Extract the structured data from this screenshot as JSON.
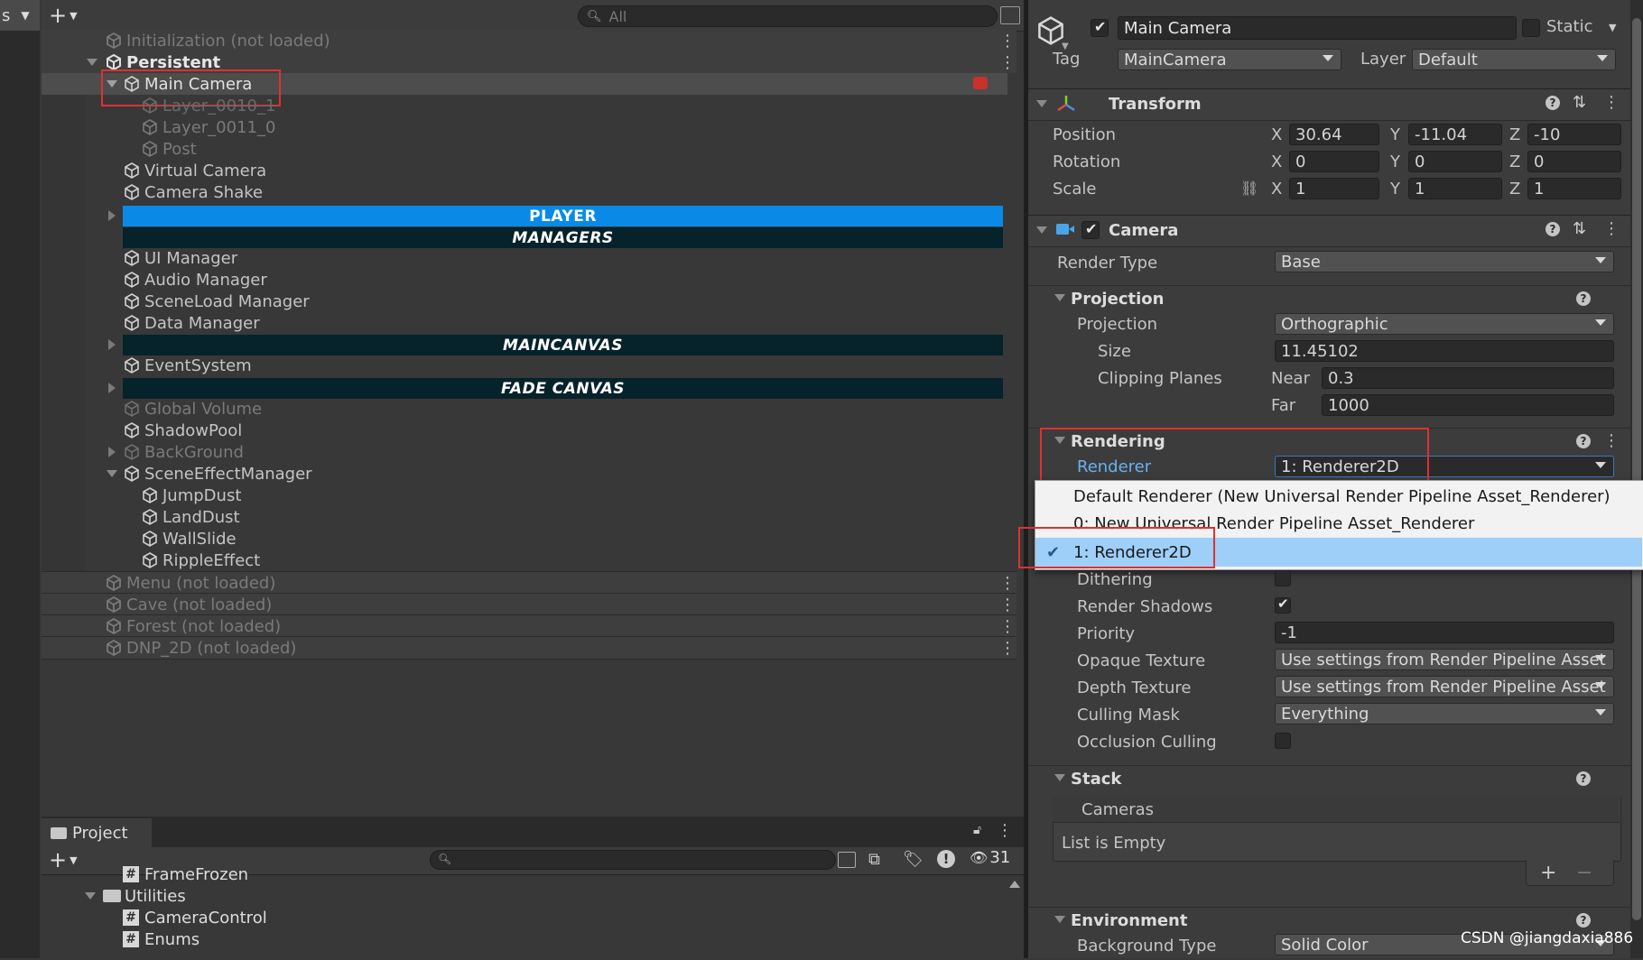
{
  "hierarchy": {
    "search_placeholder": "All",
    "rows": [
      {
        "label": "Initialization (not loaded)",
        "style": "dim",
        "indent": 0
      },
      {
        "label": "Persistent",
        "style": "bold",
        "indent": 0
      },
      {
        "label": "Main Camera",
        "style": "normal",
        "indent": 1
      },
      {
        "label": "Layer_0010_1",
        "style": "strike",
        "indent": 2
      },
      {
        "label": "Layer_0011_0",
        "style": "dimc",
        "indent": 2
      },
      {
        "label": "Post",
        "style": "dimc",
        "indent": 2
      },
      {
        "label": "Virtual Camera",
        "style": "normal",
        "indent": 1
      },
      {
        "label": "Camera Shake",
        "style": "normal",
        "indent": 1
      }
    ],
    "bar_player": "PLAYER",
    "bar_managers": "MANAGERS",
    "managers": [
      "UI Manager",
      "Audio Manager",
      "SceneLoad Manager",
      "Data Manager"
    ],
    "bar_maincanvas": "MAINCANVAS",
    "event_system": "EventSystem",
    "bar_fadecanvas": "FADE CANVAS",
    "global_volume": "Global Volume",
    "shadow_pool": "ShadowPool",
    "background": "BackGround",
    "scene_effect_manager": "SceneEffectManager",
    "effects": [
      "JumpDust",
      "LandDust",
      "WallSlide",
      "RippleEffect"
    ],
    "unloaded": [
      "Menu (not loaded)",
      "Cave (not loaded)",
      "Forest (not loaded)",
      "DNP_2D (not loaded)"
    ]
  },
  "project": {
    "tab_label": "Project",
    "hidden_count": "31",
    "items": [
      {
        "label": "FrameFrozen",
        "type": "script"
      },
      {
        "label": "Utilities",
        "type": "folder"
      },
      {
        "label": "CameraControl",
        "type": "script"
      },
      {
        "label": "Enums",
        "type": "script"
      }
    ]
  },
  "inspector": {
    "object_name": "Main Camera",
    "static_label": "Static",
    "tag_label": "Tag",
    "tag_value": "MainCamera",
    "layer_label": "Layer",
    "layer_value": "Default",
    "transform": {
      "title": "Transform",
      "position_label": "Position",
      "pos_x": "30.64",
      "pos_y": "-11.04",
      "pos_z": "-10",
      "rotation_label": "Rotation",
      "rot_x": "0",
      "rot_y": "0",
      "rot_z": "0",
      "scale_label": "Scale",
      "scale_x": "1",
      "scale_y": "1",
      "scale_z": "1",
      "x": "X",
      "y": "Y",
      "z": "Z"
    },
    "camera": {
      "title": "Camera",
      "render_type_label": "Render Type",
      "render_type": "Base",
      "projection_section": "Projection",
      "projection_label": "Projection",
      "projection": "Orthographic",
      "size_label": "Size",
      "size": "11.45102",
      "clipping_label": "Clipping Planes",
      "near_label": "Near",
      "near": "0.3",
      "far_label": "Far",
      "far": "1000",
      "rendering_section": "Rendering",
      "renderer_label": "Renderer",
      "renderer": "1: Renderer2D",
      "dithering_label": "Dithering",
      "render_shadows_label": "Render Shadows",
      "priority_label": "Priority",
      "priority": "-1",
      "opaque_label": "Opaque Texture",
      "opaque": "Use settings from Render Pipeline Asset",
      "depth_label": "Depth Texture",
      "depth": "Use settings from Render Pipeline Asset",
      "culling_label": "Culling Mask",
      "culling": "Everything",
      "occlusion_label": "Occlusion Culling",
      "stack_section": "Stack",
      "cameras_header": "Cameras",
      "list_empty": "List is Empty",
      "environment_section": "Environment",
      "bg_type_label": "Background Type",
      "bg_type": "Solid Color"
    },
    "renderer_menu": [
      "Default Renderer (New Universal Render Pipeline Asset_Renderer)",
      "0: New Universal Render Pipeline Asset_Renderer",
      "1: Renderer2D"
    ]
  },
  "top_left_tab": "s",
  "watermark": "CSDN @jiangdaxia886",
  "colors": {
    "selection": "#2c5d87",
    "player_bar": "#0a8ae6",
    "dark_bar": "#06222a",
    "menu_highlight": "#9ecff8",
    "red": "#e03030"
  }
}
